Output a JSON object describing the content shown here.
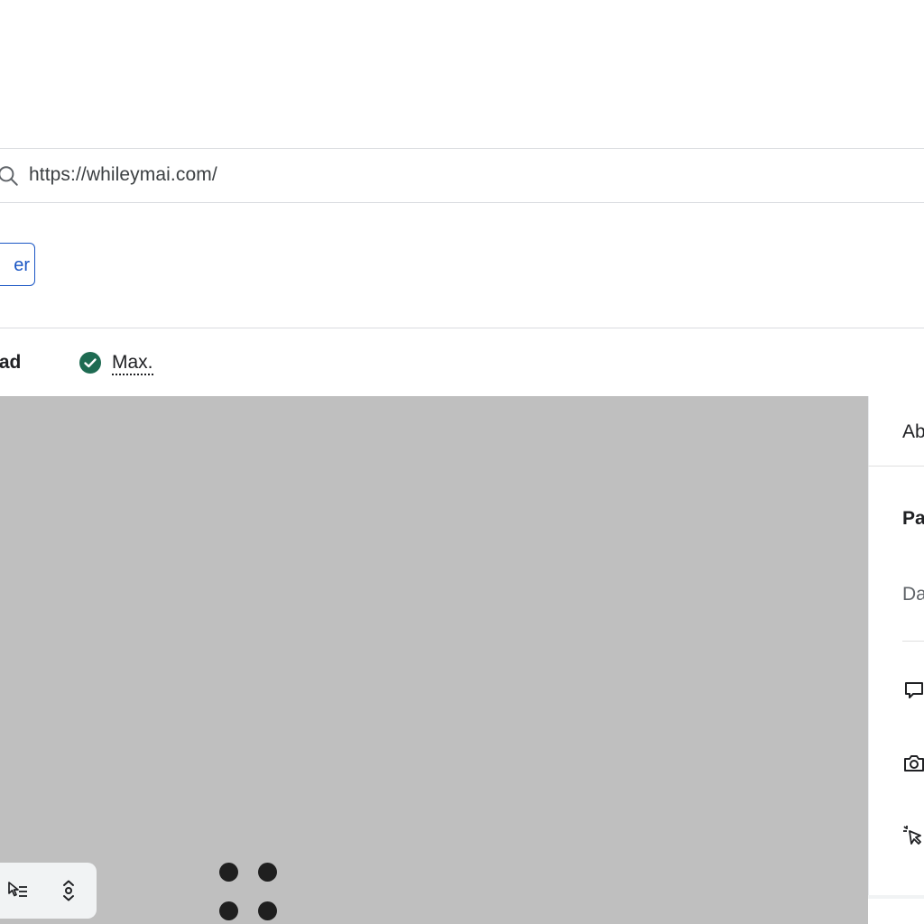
{
  "url_bar": {
    "icon": "search-icon",
    "url": "https://whileymai.com/"
  },
  "partial_button": {
    "label": "er"
  },
  "status_row": {
    "left_label": "oad",
    "check_icon": "check-circle-icon",
    "check_color": "#1e6b52",
    "max_label": "Max."
  },
  "canvas": {
    "background": "#bfbfbf"
  },
  "floating_toolbar": {
    "icons": [
      "select-list-icon",
      "expand-vertical-icon"
    ]
  },
  "drag_handle": {
    "icon": "drag-dots-icon"
  },
  "right_panel": {
    "tab_label": "Ab",
    "section_title": "Pa",
    "section_item": "Da",
    "actions": [
      "chat-reply-icon",
      "camera-icon",
      "click-cursor-icon"
    ]
  }
}
